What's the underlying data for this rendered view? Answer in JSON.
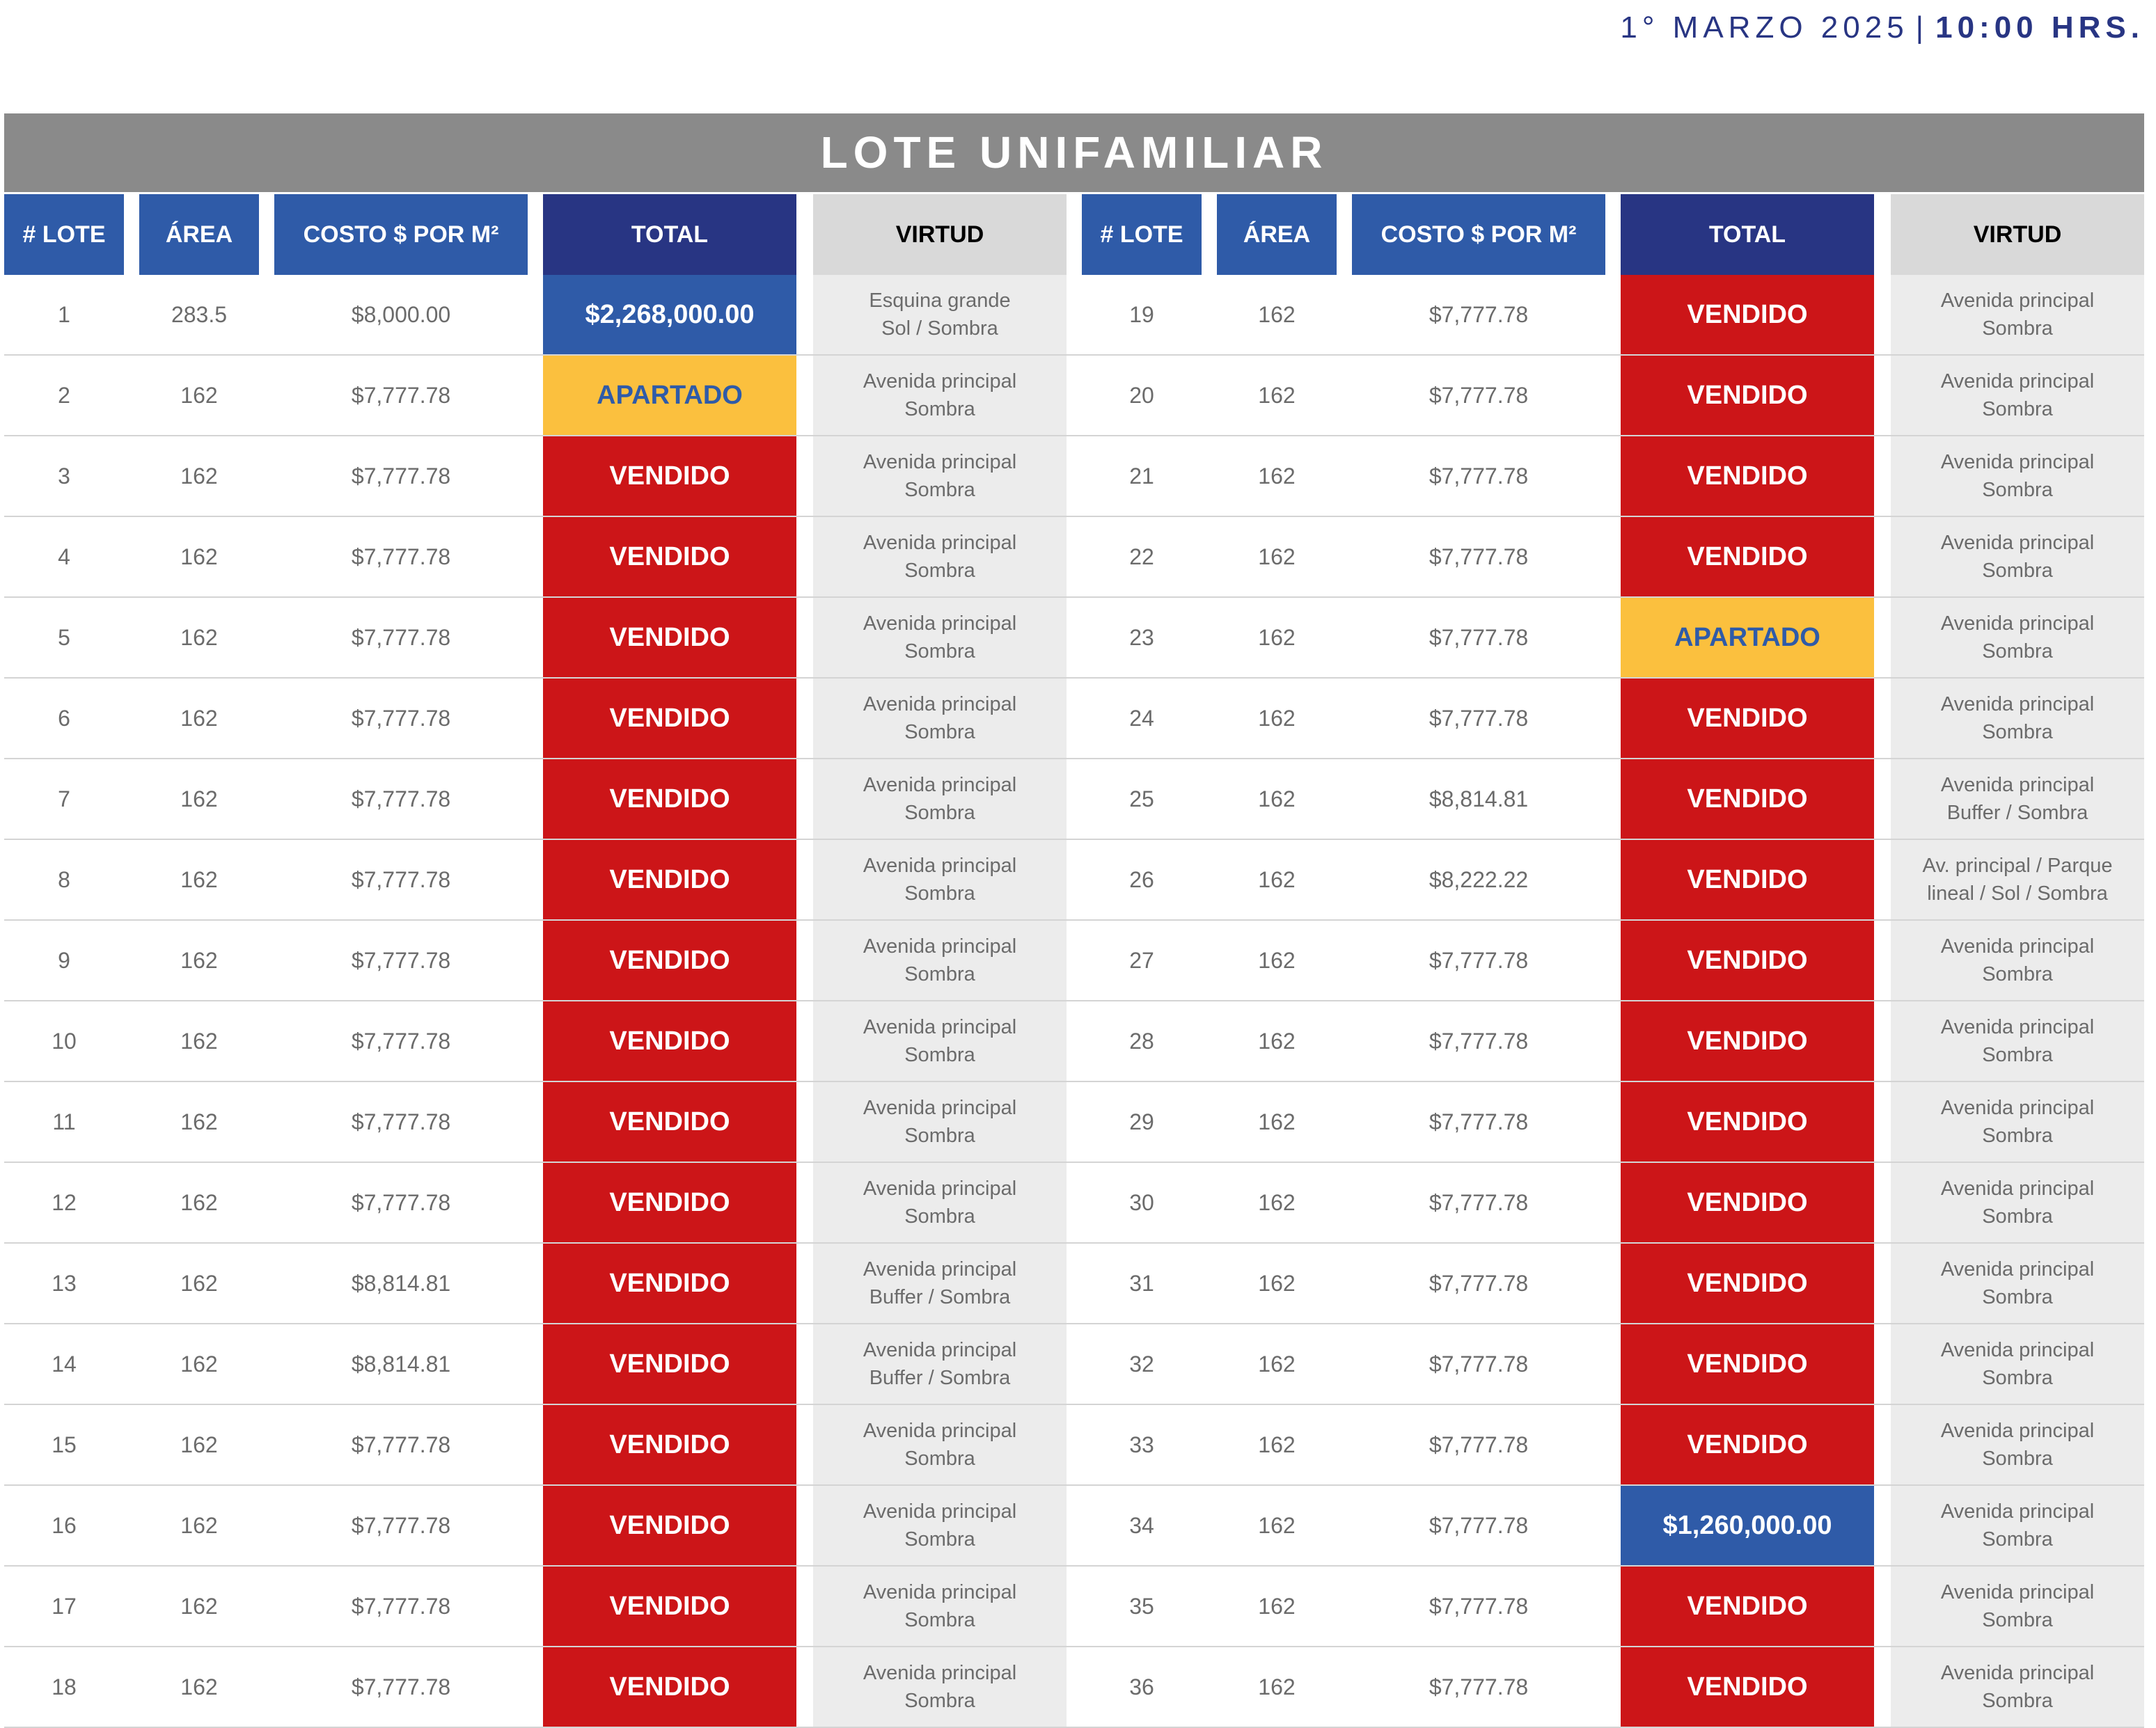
{
  "header": {
    "date": "1° MARZO 2025",
    "separator": "|",
    "time": "10:00 HRS."
  },
  "title": "LOTE UNIFAMILIAR",
  "columns": [
    "# LOTE",
    "ÁREA",
    "COSTO $ POR M²",
    "TOTAL",
    "VIRTUD"
  ],
  "colors": {
    "vendido": "#cc1518",
    "apartado": "#fbc03e",
    "precio": "#2f5ba8",
    "header_blue": "#2f5ba8",
    "header_navy": "#283583",
    "title_grey": "#8a8a8a"
  },
  "left_rows": [
    {
      "lote": "1",
      "area": "283.5",
      "costo": "$8,000.00",
      "total": "$2,268,000.00",
      "status": "precio",
      "virtud": [
        "Esquina grande",
        "Sol / Sombra"
      ]
    },
    {
      "lote": "2",
      "area": "162",
      "costo": "$7,777.78",
      "total": "APARTADO",
      "status": "apartado",
      "virtud": [
        "Avenida principal",
        "Sombra"
      ]
    },
    {
      "lote": "3",
      "area": "162",
      "costo": "$7,777.78",
      "total": "VENDIDO",
      "status": "vendido",
      "virtud": [
        "Avenida principal",
        "Sombra"
      ]
    },
    {
      "lote": "4",
      "area": "162",
      "costo": "$7,777.78",
      "total": "VENDIDO",
      "status": "vendido",
      "virtud": [
        "Avenida principal",
        "Sombra"
      ]
    },
    {
      "lote": "5",
      "area": "162",
      "costo": "$7,777.78",
      "total": "VENDIDO",
      "status": "vendido",
      "virtud": [
        "Avenida principal",
        "Sombra"
      ]
    },
    {
      "lote": "6",
      "area": "162",
      "costo": "$7,777.78",
      "total": "VENDIDO",
      "status": "vendido",
      "virtud": [
        "Avenida principal",
        "Sombra"
      ]
    },
    {
      "lote": "7",
      "area": "162",
      "costo": "$7,777.78",
      "total": "VENDIDO",
      "status": "vendido",
      "virtud": [
        "Avenida principal",
        "Sombra"
      ]
    },
    {
      "lote": "8",
      "area": "162",
      "costo": "$7,777.78",
      "total": "VENDIDO",
      "status": "vendido",
      "virtud": [
        "Avenida principal",
        "Sombra"
      ]
    },
    {
      "lote": "9",
      "area": "162",
      "costo": "$7,777.78",
      "total": "VENDIDO",
      "status": "vendido",
      "virtud": [
        "Avenida principal",
        "Sombra"
      ]
    },
    {
      "lote": "10",
      "area": "162",
      "costo": "$7,777.78",
      "total": "VENDIDO",
      "status": "vendido",
      "virtud": [
        "Avenida principal",
        "Sombra"
      ]
    },
    {
      "lote": "11",
      "area": "162",
      "costo": "$7,777.78",
      "total": "VENDIDO",
      "status": "vendido",
      "virtud": [
        "Avenida principal",
        "Sombra"
      ]
    },
    {
      "lote": "12",
      "area": "162",
      "costo": "$7,777.78",
      "total": "VENDIDO",
      "status": "vendido",
      "virtud": [
        "Avenida principal",
        "Sombra"
      ]
    },
    {
      "lote": "13",
      "area": "162",
      "costo": "$8,814.81",
      "total": "VENDIDO",
      "status": "vendido",
      "virtud": [
        "Avenida principal",
        "Buffer / Sombra"
      ]
    },
    {
      "lote": "14",
      "area": "162",
      "costo": "$8,814.81",
      "total": "VENDIDO",
      "status": "vendido",
      "virtud": [
        "Avenida principal",
        "Buffer / Sombra"
      ]
    },
    {
      "lote": "15",
      "area": "162",
      "costo": "$7,777.78",
      "total": "VENDIDO",
      "status": "vendido",
      "virtud": [
        "Avenida principal",
        "Sombra"
      ]
    },
    {
      "lote": "16",
      "area": "162",
      "costo": "$7,777.78",
      "total": "VENDIDO",
      "status": "vendido",
      "virtud": [
        "Avenida principal",
        "Sombra"
      ]
    },
    {
      "lote": "17",
      "area": "162",
      "costo": "$7,777.78",
      "total": "VENDIDO",
      "status": "vendido",
      "virtud": [
        "Avenida principal",
        "Sombra"
      ]
    },
    {
      "lote": "18",
      "area": "162",
      "costo": "$7,777.78",
      "total": "VENDIDO",
      "status": "vendido",
      "virtud": [
        "Avenida principal",
        "Sombra"
      ]
    }
  ],
  "right_rows": [
    {
      "lote": "19",
      "area": "162",
      "costo": "$7,777.78",
      "total": "VENDIDO",
      "status": "vendido",
      "virtud": [
        "Avenida principal",
        "Sombra"
      ]
    },
    {
      "lote": "20",
      "area": "162",
      "costo": "$7,777.78",
      "total": "VENDIDO",
      "status": "vendido",
      "virtud": [
        "Avenida principal",
        "Sombra"
      ]
    },
    {
      "lote": "21",
      "area": "162",
      "costo": "$7,777.78",
      "total": "VENDIDO",
      "status": "vendido",
      "virtud": [
        "Avenida principal",
        "Sombra"
      ]
    },
    {
      "lote": "22",
      "area": "162",
      "costo": "$7,777.78",
      "total": "VENDIDO",
      "status": "vendido",
      "virtud": [
        "Avenida principal",
        "Sombra"
      ]
    },
    {
      "lote": "23",
      "area": "162",
      "costo": "$7,777.78",
      "total": "APARTADO",
      "status": "apartado",
      "virtud": [
        "Avenida principal",
        "Sombra"
      ]
    },
    {
      "lote": "24",
      "area": "162",
      "costo": "$7,777.78",
      "total": "VENDIDO",
      "status": "vendido",
      "virtud": [
        "Avenida principal",
        "Sombra"
      ]
    },
    {
      "lote": "25",
      "area": "162",
      "costo": "$8,814.81",
      "total": "VENDIDO",
      "status": "vendido",
      "virtud": [
        "Avenida principal",
        "Buffer / Sombra"
      ]
    },
    {
      "lote": "26",
      "area": "162",
      "costo": "$8,222.22",
      "total": "VENDIDO",
      "status": "vendido",
      "virtud": [
        "Av. principal / Parque",
        "lineal / Sol / Sombra"
      ]
    },
    {
      "lote": "27",
      "area": "162",
      "costo": "$7,777.78",
      "total": "VENDIDO",
      "status": "vendido",
      "virtud": [
        "Avenida principal",
        "Sombra"
      ]
    },
    {
      "lote": "28",
      "area": "162",
      "costo": "$7,777.78",
      "total": "VENDIDO",
      "status": "vendido",
      "virtud": [
        "Avenida principal",
        "Sombra"
      ]
    },
    {
      "lote": "29",
      "area": "162",
      "costo": "$7,777.78",
      "total": "VENDIDO",
      "status": "vendido",
      "virtud": [
        "Avenida principal",
        "Sombra"
      ]
    },
    {
      "lote": "30",
      "area": "162",
      "costo": "$7,777.78",
      "total": "VENDIDO",
      "status": "vendido",
      "virtud": [
        "Avenida principal",
        "Sombra"
      ]
    },
    {
      "lote": "31",
      "area": "162",
      "costo": "$7,777.78",
      "total": "VENDIDO",
      "status": "vendido",
      "virtud": [
        "Avenida principal",
        "Sombra"
      ]
    },
    {
      "lote": "32",
      "area": "162",
      "costo": "$7,777.78",
      "total": "VENDIDO",
      "status": "vendido",
      "virtud": [
        "Avenida principal",
        "Sombra"
      ]
    },
    {
      "lote": "33",
      "area": "162",
      "costo": "$7,777.78",
      "total": "VENDIDO",
      "status": "vendido",
      "virtud": [
        "Avenida principal",
        "Sombra"
      ]
    },
    {
      "lote": "34",
      "area": "162",
      "costo": "$7,777.78",
      "total": "$1,260,000.00",
      "status": "precio",
      "virtud": [
        "Avenida principal",
        "Sombra"
      ]
    },
    {
      "lote": "35",
      "area": "162",
      "costo": "$7,777.78",
      "total": "VENDIDO",
      "status": "vendido",
      "virtud": [
        "Avenida principal",
        "Sombra"
      ]
    },
    {
      "lote": "36",
      "area": "162",
      "costo": "$7,777.78",
      "total": "VENDIDO",
      "status": "vendido",
      "virtud": [
        "Avenida principal",
        "Sombra"
      ]
    }
  ]
}
